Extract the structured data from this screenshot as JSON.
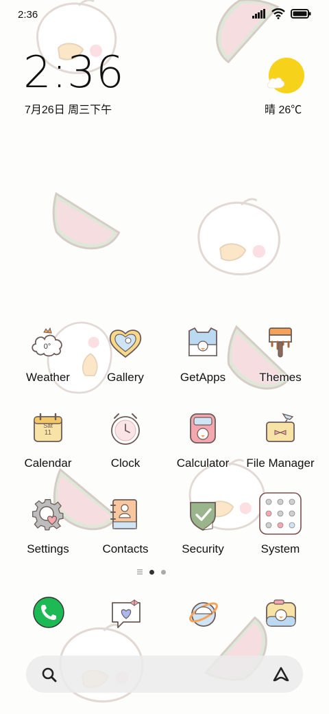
{
  "status_bar": {
    "time": "2:36",
    "icons": [
      "signal-icon",
      "wifi-icon",
      "battery-icon"
    ]
  },
  "clock_widget": {
    "time": "2:36",
    "date": "7月26日 周三下午"
  },
  "weather_widget": {
    "text": "晴 26℃",
    "icon": "sunny-cloud-icon"
  },
  "apps": [
    {
      "label": "Weather",
      "icon": "weather-icon",
      "icon_text": "0°"
    },
    {
      "label": "Gallery",
      "icon": "gallery-icon"
    },
    {
      "label": "GetApps",
      "icon": "getapps-icon"
    },
    {
      "label": "Themes",
      "icon": "themes-icon"
    },
    {
      "label": "Calendar",
      "icon": "calendar-icon",
      "icon_text": "Sat",
      "icon_sub": "11"
    },
    {
      "label": "Clock",
      "icon": "clock-icon"
    },
    {
      "label": "Calculator",
      "icon": "calculator-icon"
    },
    {
      "label": "File Manager",
      "icon": "file-manager-icon"
    },
    {
      "label": "Settings",
      "icon": "settings-icon"
    },
    {
      "label": "Contacts",
      "icon": "contacts-icon"
    },
    {
      "label": "Security",
      "icon": "security-icon"
    },
    {
      "label": "System",
      "icon": "system-folder-icon"
    }
  ],
  "page_indicator": {
    "pages": 2,
    "current": 1
  },
  "dock": [
    "phone-icon",
    "messaging-icon",
    "browser-icon",
    "camera-icon"
  ],
  "search_bar": {
    "icons": [
      "search-icon",
      "assistant-icon"
    ]
  },
  "colors": {
    "phone_green": "#1db954",
    "sun_yellow": "#f7d21a",
    "melon_pink": "#f6dde0",
    "melon_green": "#dfe8d8"
  }
}
